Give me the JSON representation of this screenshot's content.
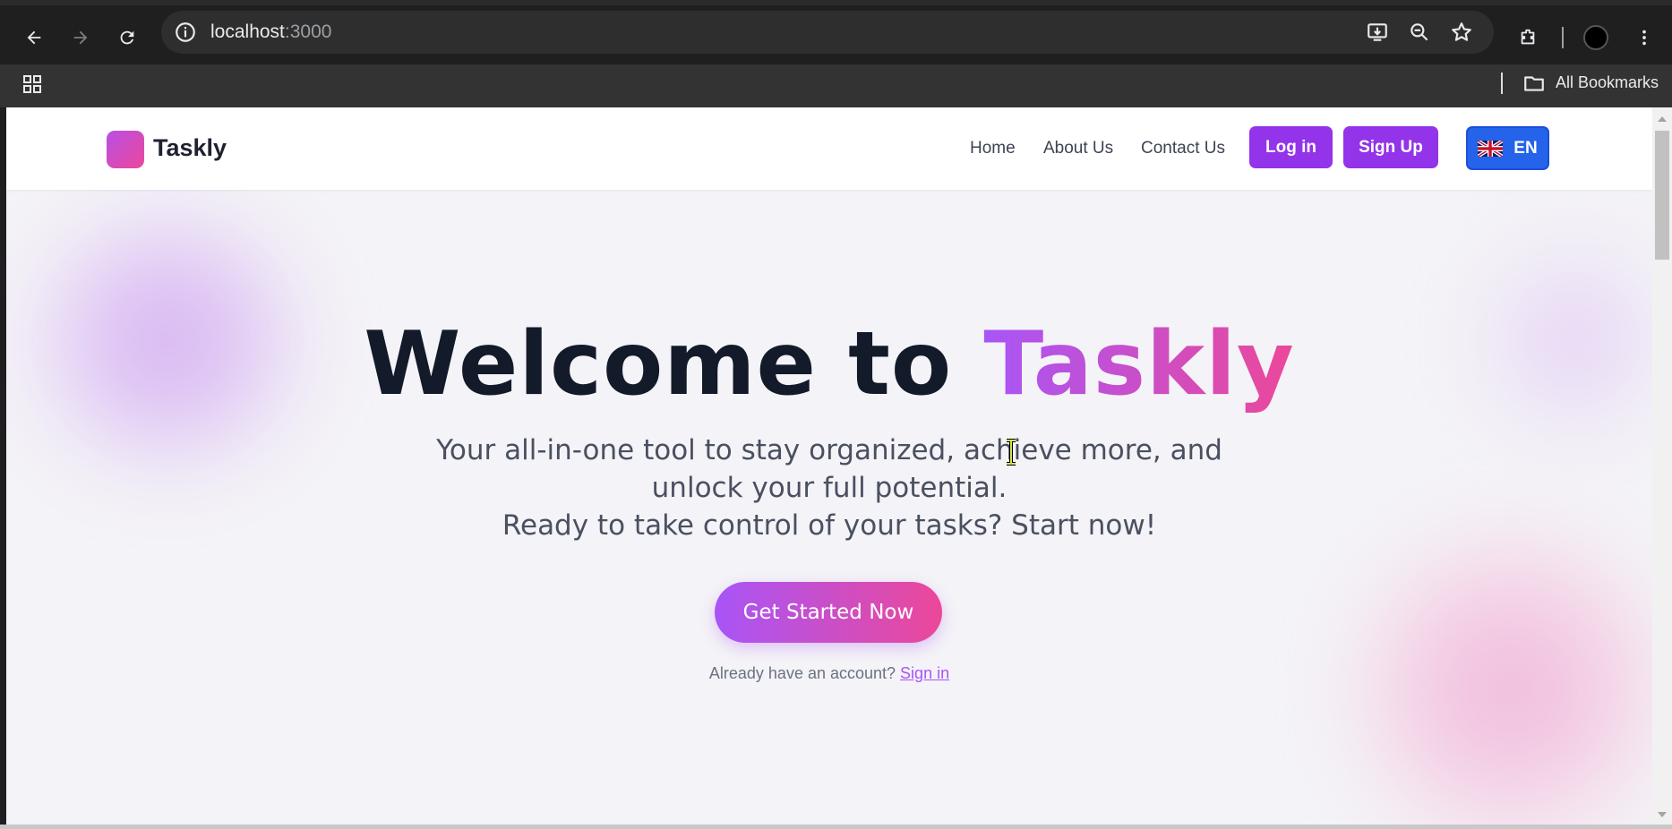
{
  "browser": {
    "url_host": "localhost",
    "url_port": ":3000",
    "bookmarks_label": "All Bookmarks"
  },
  "site": {
    "logo_text": "Taskly",
    "nav": [
      "Home",
      "About Us",
      "Contact Us"
    ],
    "login_label": "Log in",
    "signup_label": "Sign Up",
    "lang_label": "EN",
    "accent_color": "#9333ea",
    "lang_color": "#2563eb"
  },
  "hero": {
    "title_plain": "Welcome to ",
    "title_brand": "Taskly",
    "subtitle_line1": "Your all-in-one tool to stay organized, achieve more, and",
    "subtitle_line2": "unlock your full potential.",
    "subtitle_line3": "Ready to take control of your tasks? Start now!",
    "cta_label": "Get Started Now",
    "signin_prompt": "Already have an account? ",
    "signin_link": "Sign in"
  }
}
